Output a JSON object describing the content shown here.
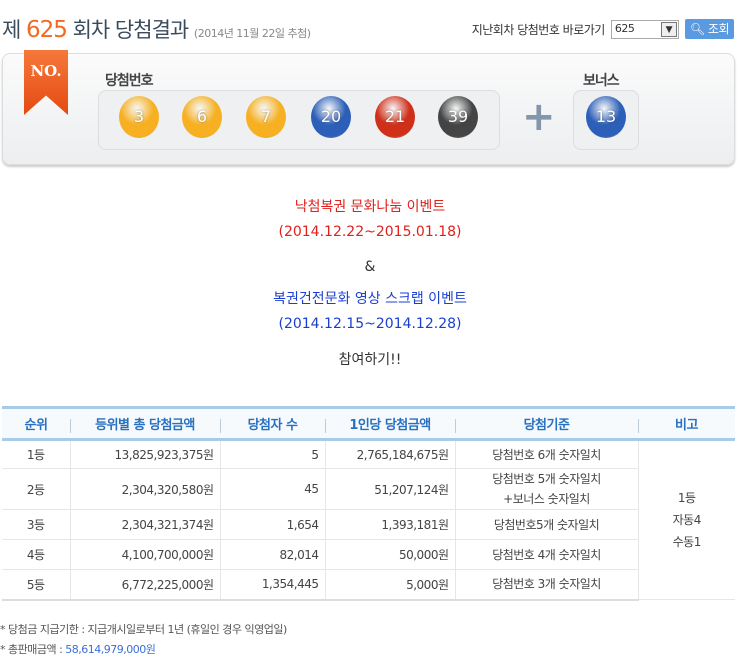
{
  "header": {
    "prefix": "제",
    "round": "625",
    "suffix": "회차 당첨결과",
    "date": "(2014년 11월 22일 추첨)"
  },
  "nav": {
    "label": "지난회차 당첨번호 바로가기",
    "selected": "625",
    "button": "조회"
  },
  "draw": {
    "badge": "NO.",
    "numbers_label": "당첨번호",
    "bonus_label": "보너스",
    "balls": [
      {
        "n": "3",
        "color": "#f6b021"
      },
      {
        "n": "6",
        "color": "#f6b021"
      },
      {
        "n": "7",
        "color": "#f6b021"
      },
      {
        "n": "20",
        "color": "#2c5fb8"
      },
      {
        "n": "21",
        "color": "#d0301a"
      },
      {
        "n": "39",
        "color": "#444444"
      }
    ],
    "bonus": {
      "n": "13",
      "color": "#2c5fb8"
    },
    "plus": "+"
  },
  "event": {
    "line1": "낙첨복권 문화나눔 이벤트",
    "line2": "(2014.12.22~2015.01.18)",
    "amp": "&",
    "line3": "복권건전문화 영상 스크랩 이벤트",
    "line4": "(2014.12.15~2014.12.28)",
    "cta": "참여하기!!"
  },
  "table": {
    "headers": [
      "순위",
      "등위별 총 당첨금액",
      "당첨자 수",
      "1인당 당첨금액",
      "당첨기준",
      "비고"
    ],
    "rows": [
      {
        "rank": "1등",
        "total": "13,825,923,375원",
        "winners": "5",
        "per": "2,765,184,675원",
        "crit": "당첨번호 6개 숫자일치",
        "crit2": ""
      },
      {
        "rank": "2등",
        "total": "2,304,320,580원",
        "winners": "45",
        "per": "51,207,124원",
        "crit": "당첨번호 5개 숫자일치",
        "crit2": "+보너스 숫자일치"
      },
      {
        "rank": "3등",
        "total": "2,304,321,374원",
        "winners": "1,654",
        "per": "1,393,181원",
        "crit": "당첨번호5개 숫자일치",
        "crit2": ""
      },
      {
        "rank": "4등",
        "total": "4,100,700,000원",
        "winners": "82,014",
        "per": "50,000원",
        "crit": "당첨번호 4개 숫자일치",
        "crit2": ""
      },
      {
        "rank": "5등",
        "total": "6,772,225,000원",
        "winners": "1,354,445",
        "per": "5,000원",
        "crit": "당첨번호 3개 숫자일치",
        "crit2": ""
      }
    ],
    "note": [
      "1등",
      "자동4",
      "수동1"
    ]
  },
  "footer": {
    "deadline": "* 당첨금 지급기한 : 지급개시일로부터 1년 (휴일인 경우 익영업일)",
    "sales_label": "* 총판매금액 : ",
    "sales_value": "58,614,979,000원"
  }
}
